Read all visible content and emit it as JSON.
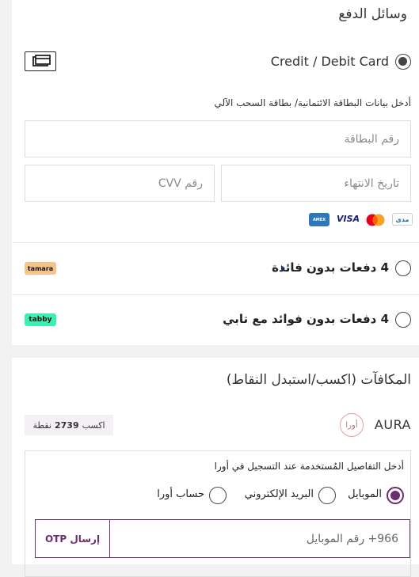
{
  "payment": {
    "title": "وسائل الدفع",
    "card_option": {
      "label": "Credit / Debit Card",
      "hint": "أدخل بيانات البطاقة الائتمانية/ بطاقة السحب الآلي",
      "card_number_placeholder": "رقم البطاقة",
      "expiry_placeholder": "تاريخ الانتهاء",
      "cvv_placeholder": "رقم CVV",
      "brands": [
        "مدى",
        "MasterCard",
        "VISA",
        "AMEX"
      ],
      "selected": true
    },
    "tamara": {
      "label": "4 دفعات بدون فائدة",
      "badge": "tamara"
    },
    "tabby": {
      "label": "4 دفعات بدون فوائد مع تابي",
      "badge": "tabby"
    }
  },
  "rewards": {
    "title": "المكافآت (اكسب/استبدل النقاط)",
    "aura_label": "AURA",
    "aura_logo_text": "أورا",
    "earn_prefix": "اكسب",
    "earn_points": "2739",
    "earn_suffix": "نقطة",
    "details_hint": "أدخل التفاصيل المُستخدمة عند التسجيل في أورا",
    "methods": [
      {
        "label": "الموبايل",
        "selected": true
      },
      {
        "label": "البريد الإلكتروني",
        "selected": false
      },
      {
        "label": "حساب أورا",
        "selected": false
      }
    ],
    "mobile_placeholder": "966+  رقم الموبايل",
    "send_otp_label": "إرسال OTP"
  },
  "colors": {
    "accent": "#6d2c6f",
    "tamara_bg": "#f5c48a",
    "tabby_bg": "#3bf0b0"
  }
}
